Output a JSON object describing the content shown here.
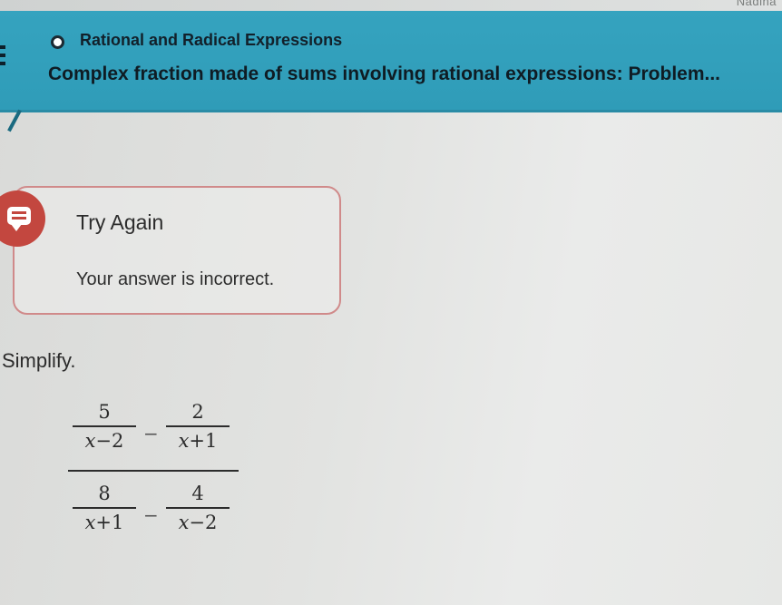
{
  "top_strip": {
    "text": "Nadina"
  },
  "header": {
    "topic": "Rational and Radical Expressions",
    "problem_title": "Complex fraction made of sums involving rational expressions: Problem..."
  },
  "feedback": {
    "title": "Try Again",
    "message": "Your answer is incorrect.",
    "accent_color": "#c3473f"
  },
  "problem": {
    "instruction": "Simplify.",
    "numerator": {
      "left": {
        "num": "5",
        "den_var": "x",
        "den_op": "−",
        "den_const": "2"
      },
      "operator": "−",
      "right": {
        "num": "2",
        "den_var": "x",
        "den_op": "+",
        "den_const": "1"
      }
    },
    "denominator": {
      "left": {
        "num": "8",
        "den_var": "x",
        "den_op": "+",
        "den_const": "1"
      },
      "operator": "−",
      "right": {
        "num": "4",
        "den_var": "x",
        "den_op": "−",
        "den_const": "2"
      }
    }
  },
  "colors": {
    "header": "#35a3bf",
    "feedback_border": "#d08a8a"
  }
}
